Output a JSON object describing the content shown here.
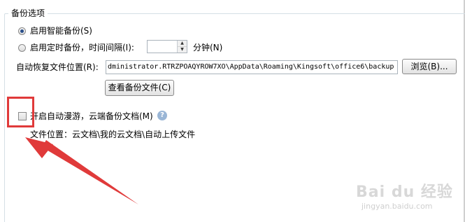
{
  "group": {
    "title": "备份选项"
  },
  "smart_backup": {
    "label": "启用智能备份(S)",
    "checked": true
  },
  "timed_backup": {
    "label": "启用定时备份，时间间隔(I):",
    "interval_value": "",
    "unit_label": "分钟(N)",
    "checked": false
  },
  "auto_recover": {
    "label": "自动恢复文件位置(R):",
    "path": "dministrator.RTRZPOAQYROW7XO\\AppData\\Roaming\\Kingsoft\\office6\\backup",
    "browse_label": "浏览(B)..."
  },
  "view_backup_label": "查看备份文件(C)",
  "roaming": {
    "label": "开启自动漫游，云端备份文档(M)",
    "checked": false,
    "help_icon": "question-icon"
  },
  "file_location": {
    "text": "文件位置：云文档\\我的云文档\\自动上传文件"
  },
  "annotation": {
    "highlight_color": "#e03a3a",
    "arrow_color": "#e03a3a"
  },
  "watermark": {
    "brand": "Bai du 经验",
    "url": "jingyan.baidu.com"
  }
}
